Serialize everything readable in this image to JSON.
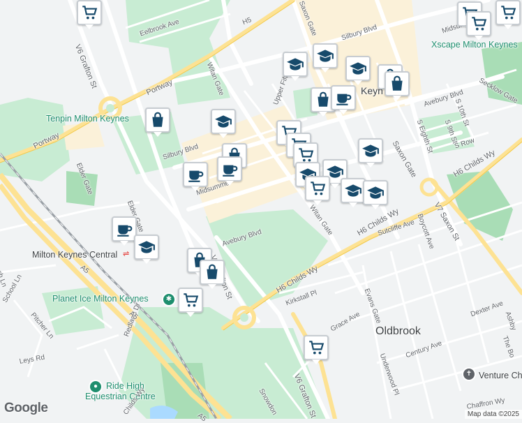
{
  "map": {
    "colors": {
      "land": "#f1f3f4",
      "park": "#c8ecd3",
      "park_dark": "#a9ddb6",
      "commercial": "#fbf1d9",
      "road": "#ffffff",
      "major_road": "#fde293",
      "water": "#aadaff",
      "marker_icon": "#174a6b"
    },
    "area_labels": [
      {
        "text": "Oldbrook"
      }
    ],
    "poi_labels": [
      {
        "text": "Tenpin Milton Keynes"
      },
      {
        "text": "Xscape Milton Keynes"
      },
      {
        "text": "Planet Ice Milton Keynes"
      },
      {
        "text": "Ride High"
      },
      {
        "text": "Equestrian Centre"
      },
      {
        "text": "Milton Keynes Central"
      },
      {
        "text": "Venture Ch"
      },
      {
        "text": "Keyn"
      }
    ],
    "street_labels": [
      {
        "text": "Eelbrook Ave"
      },
      {
        "text": "H5"
      },
      {
        "text": "Portway"
      },
      {
        "text": "Portway"
      },
      {
        "text": "Witan Gate"
      },
      {
        "text": "Saxon Gate"
      },
      {
        "text": "Silbury Blvd"
      },
      {
        "text": "Silbury Blvd"
      },
      {
        "text": "Midsumme"
      },
      {
        "text": "Midsum"
      },
      {
        "text": "Upper Fift"
      },
      {
        "text": "Avebury Blvd"
      },
      {
        "text": "Avebury Blvd"
      },
      {
        "text": "Elder Gate"
      },
      {
        "text": "Elder Gate"
      },
      {
        "text": "V6 Grafton St"
      },
      {
        "text": "V6 Grafton St"
      },
      {
        "text": "V6 Grafton St"
      },
      {
        "text": "H6 Childs Wy"
      },
      {
        "text": "H6 Childs Wy"
      },
      {
        "text": "H6 Childs Wy"
      },
      {
        "text": "Saxon Gate"
      },
      {
        "text": "V7 Saxon St"
      },
      {
        "text": "Sutcliffe Ave"
      },
      {
        "text": "Boycott Ave"
      },
      {
        "text": "Secklow Gate"
      },
      {
        "text": "S 10th St"
      },
      {
        "text": "S 9th St"
      },
      {
        "text": "S Eighth St"
      },
      {
        "text": "S Row"
      },
      {
        "text": "Witan Gate"
      },
      {
        "text": "Kirkstall Pl"
      },
      {
        "text": "Evans Gate"
      },
      {
        "text": "Grace Ave"
      },
      {
        "text": "Dexter Ave"
      },
      {
        "text": "Century Ave"
      },
      {
        "text": "Underwood Pl"
      },
      {
        "text": "Redland Dr"
      },
      {
        "text": "Leys Rd"
      },
      {
        "text": "Pitcher Ln"
      },
      {
        "text": "School Ln"
      },
      {
        "text": "ch Ln"
      },
      {
        "text": "A5"
      },
      {
        "text": "A5"
      },
      {
        "text": "A5"
      },
      {
        "text": "Snowdon"
      },
      {
        "text": "Childs Wy"
      },
      {
        "text": "Chaffron Wy"
      },
      {
        "text": "Ashby"
      },
      {
        "text": "The Bo"
      }
    ],
    "markers": [
      {
        "icon": "shopping-cart-icon"
      },
      {
        "icon": "shopping-cart-icon"
      },
      {
        "icon": "shopping-cart-icon"
      },
      {
        "icon": "shopping-cart-icon"
      },
      {
        "icon": "graduation-cap-icon"
      },
      {
        "icon": "graduation-cap-icon"
      },
      {
        "icon": "graduation-cap-icon"
      },
      {
        "icon": "shopping-bag-icon"
      },
      {
        "icon": "shopping-bag-icon"
      },
      {
        "icon": "shopping-bag-icon"
      },
      {
        "icon": "coffee-cup-icon"
      },
      {
        "icon": "shopping-bag-icon"
      },
      {
        "icon": "graduation-cap-icon"
      },
      {
        "icon": "shopping-bag-icon"
      },
      {
        "icon": "coffee-cup-icon"
      },
      {
        "icon": "coffee-cup-icon"
      },
      {
        "icon": "shopping-cart-icon"
      },
      {
        "icon": "shopping-cart-icon"
      },
      {
        "icon": "shopping-cart-icon"
      },
      {
        "icon": "graduation-cap-icon"
      },
      {
        "icon": "graduation-cap-icon"
      },
      {
        "icon": "graduation-cap-icon"
      },
      {
        "icon": "graduation-cap-icon"
      },
      {
        "icon": "shopping-cart-icon"
      },
      {
        "icon": "graduation-cap-icon"
      },
      {
        "icon": "coffee-cup-icon"
      },
      {
        "icon": "graduation-cap-icon"
      },
      {
        "icon": "shopping-bag-icon"
      },
      {
        "icon": "shopping-bag-icon"
      },
      {
        "icon": "shopping-cart-icon"
      },
      {
        "icon": "shopping-cart-icon"
      }
    ],
    "route_shields": [
      "A5",
      "A5"
    ],
    "rail_station_icon": "rail-icon",
    "poi_icons": [
      "place-of-worship-icon",
      "leisure-icon",
      "leisure-icon"
    ],
    "google_logo": "Google",
    "attribution": "Map data ©2025"
  }
}
